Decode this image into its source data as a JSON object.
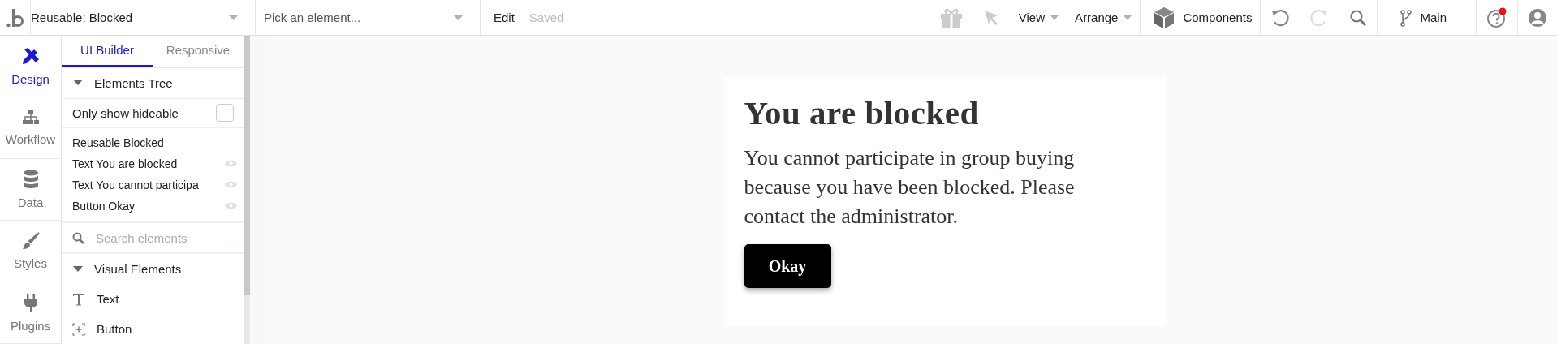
{
  "topbar": {
    "page_dropdown": {
      "value": "Reusable: Blocked"
    },
    "element_picker": {
      "placeholder": "Pick an element..."
    },
    "edit": "Edit",
    "status": "Saved",
    "view": "View",
    "arrange": "Arrange",
    "components": "Components",
    "branch": "Main",
    "help_notification": true
  },
  "rail": [
    {
      "label": "Design",
      "kind": "design",
      "selected": true
    },
    {
      "label": "Workflow",
      "kind": "workflow",
      "selected": false
    },
    {
      "label": "Data",
      "kind": "data",
      "selected": false
    },
    {
      "label": "Styles",
      "kind": "styles",
      "selected": false
    },
    {
      "label": "Plugins",
      "kind": "plugins",
      "selected": false
    }
  ],
  "panel": {
    "tabs": [
      {
        "label": "UI Builder",
        "selected": true
      },
      {
        "label": "Responsive",
        "selected": false
      }
    ],
    "elements_tree": {
      "title": "Elements Tree",
      "expanded": true
    },
    "only_show_hideable": {
      "label": "Only show hideable",
      "checked": false
    },
    "tree": [
      {
        "label": "Reusable Blocked",
        "kind": "reusable"
      },
      {
        "label": "Text You are blocked",
        "kind": "element"
      },
      {
        "label": "Text You cannot participa",
        "kind": "element"
      },
      {
        "label": "Button Okay",
        "kind": "element"
      }
    ],
    "search": {
      "placeholder": "Search elements"
    },
    "visual_elements": {
      "title": "Visual Elements",
      "expanded": true,
      "items": [
        {
          "label": "Text",
          "kind": "text"
        },
        {
          "label": "Button",
          "kind": "button"
        }
      ]
    }
  },
  "canvas": {
    "title": "You are blocked",
    "message": "You cannot participate in group buying because you have been blocked. Please contact the administrator.",
    "button": "Okay"
  }
}
